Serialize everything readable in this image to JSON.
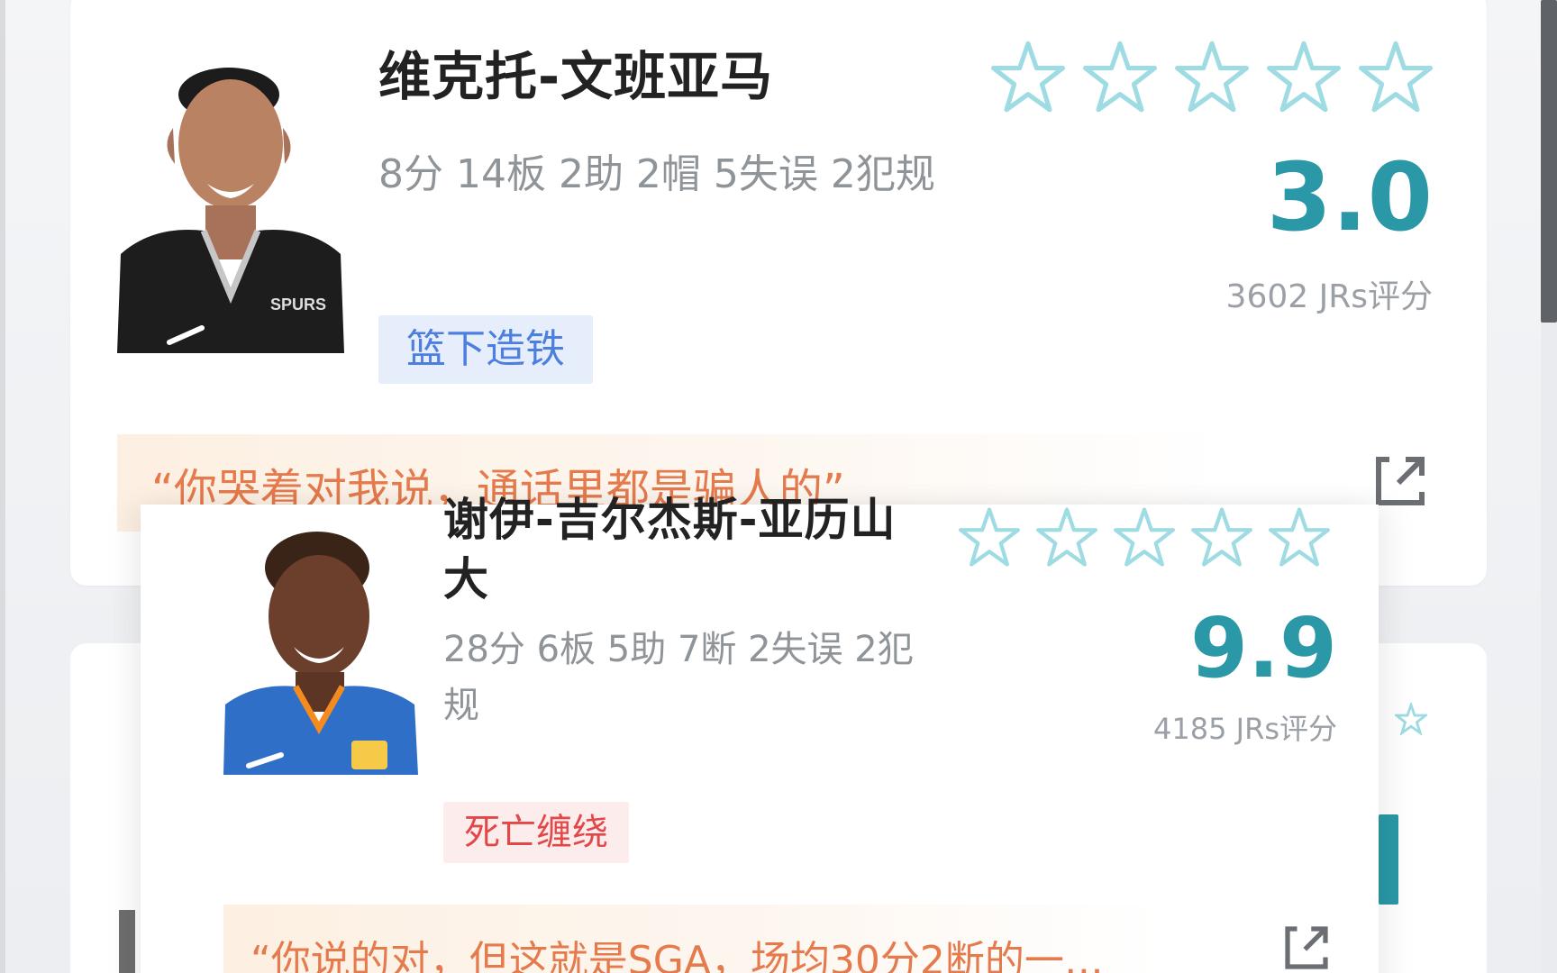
{
  "players": [
    {
      "name": "维克托-文班亚马",
      "stats": "8分 14板 2助 2帽 5失误 2犯规",
      "tag": "篮下造铁",
      "score": "3.0",
      "votes": "3602 JRs评分",
      "comment": "“你哭着对我说，通话里都是骗人的”",
      "rating_stars_filled": 0,
      "rating_stars_total": 5,
      "jersey": "SPURS"
    },
    {
      "name": "谢伊-吉尔杰斯-亚历山大",
      "stats": "28分 6板 5助 7断 2失误 2犯规",
      "tag": "死亡缠绕",
      "score": "9.9",
      "votes": "4185 JRs评分",
      "comment": "“你说的对，但这就是SGA，场均30分2断的一…",
      "rating_stars_filled": 0,
      "rating_stars_total": 5
    }
  ],
  "colors": {
    "accent": "#2a98a6",
    "star_outline": "#9fdbe3",
    "tag_blue": "#4d7fde",
    "tag_red": "#e24848",
    "comment_text": "#e57a4d"
  },
  "icons": {
    "share": "share-external-icon",
    "star": "star-outline-icon"
  }
}
